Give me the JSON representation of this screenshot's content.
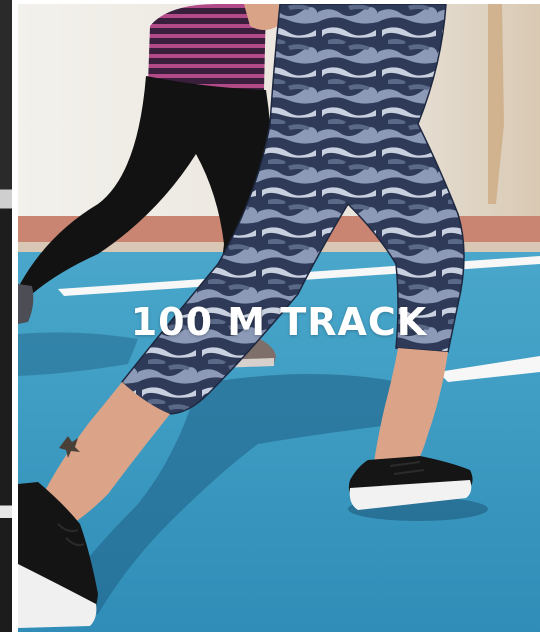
{
  "caption": "100 M TRACK",
  "colors": {
    "track": "#3b9cc2",
    "wall": "#e9e4dd",
    "leggings_camo": "#3c4a66",
    "caption": "#ffffff"
  },
  "icons": {
    "shoe": "sneaker-icon",
    "tattoo": "tattoo-mark"
  }
}
